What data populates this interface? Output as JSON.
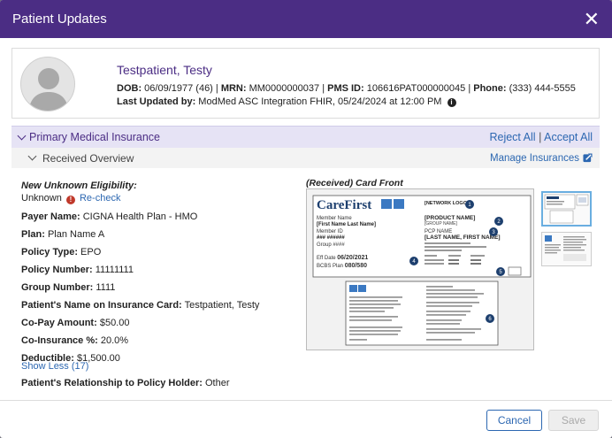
{
  "modal": {
    "title": "Patient Updates"
  },
  "patient": {
    "name": "Testpatient, Testy",
    "dob_label": "DOB:",
    "dob": "06/09/1977 (46)",
    "mrn_label": "MRN:",
    "mrn": "MM0000000037",
    "pms_label": "PMS ID:",
    "pms": "106616PAT000000045",
    "phone_label": "Phone:",
    "phone": "(333) 444-5555",
    "updated_label": "Last Updated by:",
    "updated": "ModMed ASC Integration FHIR, 05/24/2024 at 12:00 PM",
    "sep": "|"
  },
  "insurance": {
    "section_title": "Primary Medical Insurance",
    "reject_all": "Reject All",
    "accept_all": "Accept All",
    "sep": "|",
    "sub_title": "Received Overview",
    "manage": "Manage Insurances",
    "eligibility_label": "New Unknown Eligibility:",
    "eligibility_value": "Unknown",
    "recheck": "Re-check",
    "fields": [
      {
        "label": "Payer Name:",
        "value": "CIGNA Health Plan - HMO"
      },
      {
        "label": "Plan:",
        "value": "Plan Name A"
      },
      {
        "label": "Policy Type:",
        "value": "EPO"
      },
      {
        "label": "Policy Number:",
        "value": "11111111"
      },
      {
        "label": "Group Number:",
        "value": "1111"
      },
      {
        "label": "Patient's Name on Insurance Card:",
        "value": "Testpatient, Testy"
      },
      {
        "label": "Co-Pay Amount:",
        "value": "$50.00"
      },
      {
        "label": "Co-Insurance %:",
        "value": "20.0%"
      },
      {
        "label": "Deductible:",
        "value": "$1,500.00"
      }
    ],
    "show_less": "Show Less (17)",
    "relationship_label": "Patient's Relationship to Policy Holder:",
    "relationship_value": "Other",
    "card_label": "(Received) Card Front"
  },
  "card": {
    "brand": "CareFirst",
    "network_logo": "[NETWORK LOGO]",
    "member_name_label": "Member Name",
    "member_name": "[First Name Last Name]",
    "member_id_label": "Member ID",
    "member_id": "### ######",
    "group_label": "Group ####",
    "product_name": "[PRODUCT NAME]",
    "group_name": "[GROUP NAME]",
    "pcp_label": "PCP NAME",
    "pcp_name": "[LAST NAME, FIRST NAME]",
    "eff_label": "Eff Date",
    "eff_date": "06/20/2021",
    "bcbs_label": "BCBS Plan",
    "bcbs_plan": "080/580",
    "numbers": [
      "1",
      "2",
      "3",
      "4",
      "5",
      "6"
    ]
  },
  "footer": {
    "cancel": "Cancel",
    "save": "Save"
  },
  "colors": {
    "header": "#4b2d84",
    "section_bg": "#e6e3f5",
    "link": "#2c67b1",
    "badge": "#1d3f6e"
  }
}
